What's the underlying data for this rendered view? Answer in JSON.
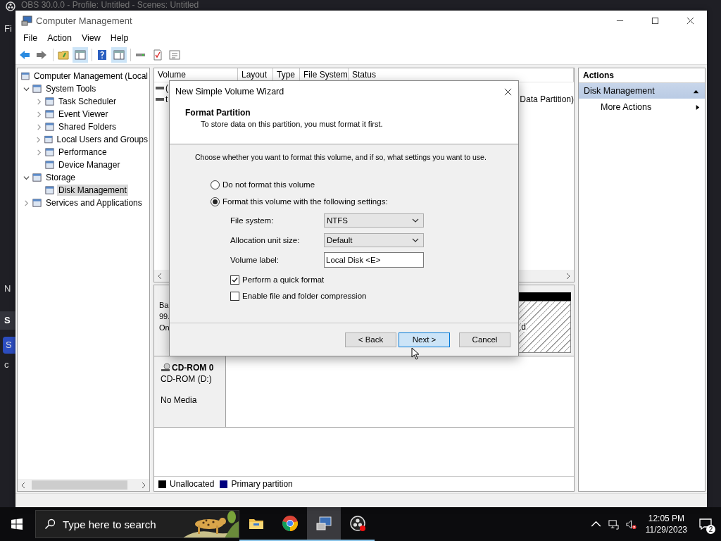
{
  "background_app": {
    "title": "OBS 30.0.0 - Profile: Untitled - Scenes: Untitled",
    "menu_fragment": "Fi",
    "side_fragments": [
      {
        "text": "N",
        "kind": "plain"
      },
      {
        "text": "S",
        "kind": "header"
      },
      {
        "text": "S",
        "kind": "selected"
      },
      {
        "text": "c",
        "kind": "plain"
      }
    ]
  },
  "window": {
    "title": "Computer Management"
  },
  "menu": [
    "File",
    "Action",
    "View",
    "Help"
  ],
  "tree": [
    {
      "label": "Computer Management (Local",
      "selected": false,
      "children": [
        {
          "label": "System Tools",
          "selected": false,
          "expanded": true,
          "children": [
            {
              "label": "Task Scheduler",
              "selected": false,
              "expanded": false
            },
            {
              "label": "Event Viewer",
              "selected": false,
              "expanded": false
            },
            {
              "label": "Shared Folders",
              "selected": false,
              "expanded": false
            },
            {
              "label": "Local Users and Groups",
              "selected": false,
              "expanded": false
            },
            {
              "label": "Performance",
              "selected": false,
              "expanded": false
            },
            {
              "label": "Device Manager",
              "selected": false
            }
          ]
        },
        {
          "label": "Storage",
          "selected": false,
          "expanded": true,
          "children": [
            {
              "label": "Disk Management",
              "selected": true
            }
          ]
        },
        {
          "label": "Services and Applications",
          "selected": false,
          "expanded": false
        }
      ]
    }
  ],
  "volume_list": {
    "columns": [
      "Volume",
      "Layout",
      "Type",
      "File System",
      "Status"
    ],
    "rows": [
      {
        "volume": "("
      },
      {
        "volume": "t",
        "status": "Data Partition)"
      }
    ]
  },
  "disks": [
    {
      "kind": "disk",
      "label_lines": [
        "Ba",
        "99.",
        "On"
      ],
      "partition_fragment": "d"
    },
    {
      "kind": "cdrom",
      "name": "CD-ROM 0",
      "label_lines": [
        "CD-ROM (D:)",
        "No Media"
      ]
    }
  ],
  "legend": [
    {
      "label": "Unallocated",
      "color": "#000000"
    },
    {
      "label": "Primary partition",
      "color": "#00007f"
    }
  ],
  "actions": {
    "title": "Actions",
    "section": {
      "label": "Disk Management",
      "expanded": true
    },
    "items": [
      "More Actions"
    ]
  },
  "dialog": {
    "title": "New Simple Volume Wizard",
    "heading": "Format Partition",
    "subheading": "To store data on this partition, you must format it first.",
    "prompt": "Choose whether you want to format this volume, and if so, what settings you want to use.",
    "format_options": [
      {
        "label": "Do not format this volume",
        "selected": false
      },
      {
        "label": "Format this volume with the following settings:",
        "selected": true
      }
    ],
    "fields": [
      {
        "kind": "select",
        "label": "File system:",
        "value": "NTFS"
      },
      {
        "kind": "select",
        "label": "Allocation unit size:",
        "value": "Default"
      },
      {
        "kind": "text",
        "label": "Volume label:",
        "value": "Local Disk <E>"
      }
    ],
    "checkboxes": [
      {
        "label": "Perform a quick format",
        "checked": true
      },
      {
        "label": "Enable file and folder compression",
        "checked": false
      }
    ],
    "buttons": [
      {
        "label": "< Back",
        "highlighted": false
      },
      {
        "label": "Next >",
        "highlighted": true
      },
      {
        "label": "Cancel",
        "highlighted": false
      }
    ]
  },
  "taskbar": {
    "search": {
      "placeholder": "Type here to search"
    },
    "apps": [
      {
        "kind": "explorer",
        "active": false
      },
      {
        "kind": "chrome",
        "active": false
      },
      {
        "kind": "computer",
        "active": true
      },
      {
        "kind": "obs",
        "active": false
      }
    ],
    "time": "12:05 PM",
    "date": "11/29/2023",
    "notifications": "2"
  }
}
